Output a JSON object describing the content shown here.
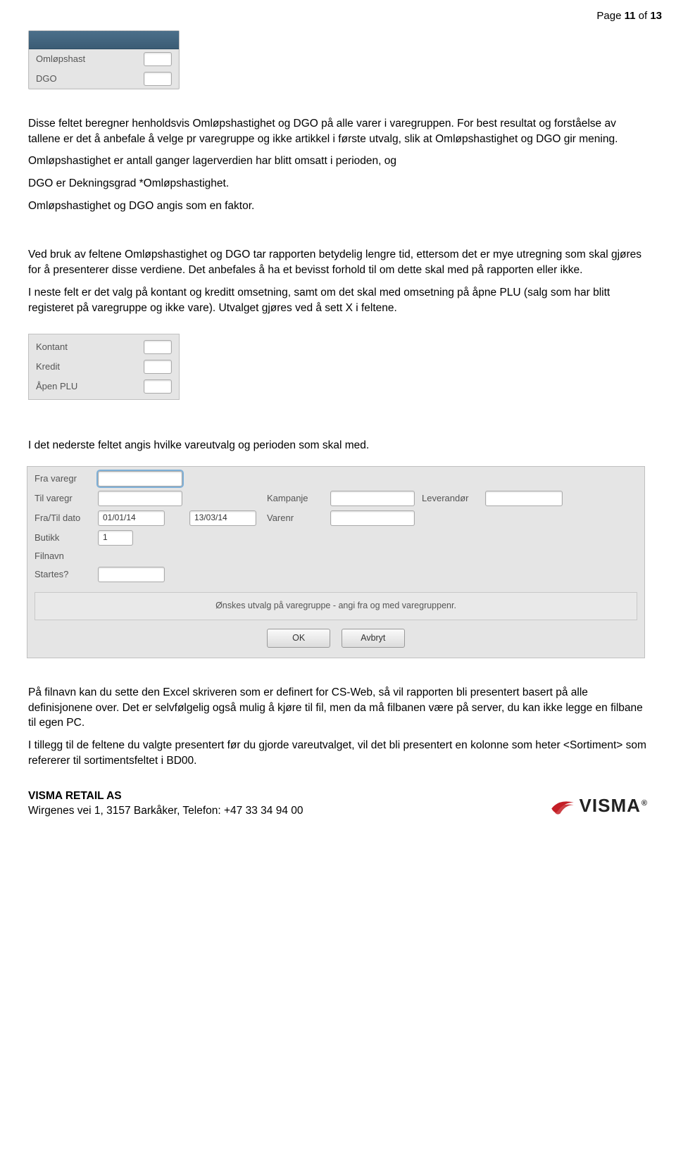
{
  "page_number_prefix": "Page ",
  "page_number_current": "11",
  "page_number_of": " of ",
  "page_number_total": "13",
  "panel1": {
    "row1": "Omløpshast",
    "row2": "DGO"
  },
  "body": {
    "p1": "Disse feltet beregner henholdsvis Omløpshastighet og DGO på alle varer i varegruppen. For best resultat og forståelse av tallene er det å anbefale å velge pr varegruppe og ikke artikkel i første utvalg, slik at Omløpshastighet og DGO gir mening.",
    "p2": "Omløpshastighet er antall ganger lagerverdien har blitt omsatt i perioden, og",
    "p3": "DGO er Dekningsgrad *Omløpshastighet.",
    "p4": "Omløpshastighet og DGO angis som en faktor.",
    "p5": "Ved bruk av feltene Omløpshastighet og DGO tar rapporten betydelig lengre tid, ettersom det er mye utregning som skal gjøres for å presenterer disse verdiene. Det anbefales å ha et bevisst forhold til om dette skal med på rapporten eller ikke.",
    "p6": "I neste felt er det valg på kontant og kreditt omsetning, samt om det skal med omsetning på åpne PLU (salg som har blitt registeret på varegruppe og ikke vare). Utvalget gjøres ved å sett X i feltene.",
    "p7": "I det nederste feltet angis hvilke vareutvalg og perioden som skal med.",
    "p8": "På filnavn kan du sette den Excel skriveren som er definert for CS-Web, så vil rapporten bli presentert basert på alle definisjonene over. Det er selvfølgelig også mulig å kjøre til fil, men da må filbanen være på server, du kan ikke legge en filbane til egen PC.",
    "p9": "I tillegg til de feltene du valgte presentert før du gjorde vareutvalget, vil det bli presentert en kolonne som heter <Sortiment> som refererer til sortimentsfeltet i BD00."
  },
  "panel2": {
    "row1": "Kontant",
    "row2": "Kredit",
    "row3": "Åpen PLU"
  },
  "form": {
    "fra_varegr": "Fra varegr",
    "til_varegr": "Til varegr",
    "kampanje": "Kampanje",
    "leverandor": "Leverandør",
    "fra_til_dato": "Fra/Til dato",
    "dato_fra_val": "01/01/14",
    "dato_til_val": "13/03/14",
    "varenr": "Varenr",
    "butikk": "Butikk",
    "butikk_val": "1",
    "filnavn": "Filnavn",
    "startes": "Startes?",
    "note": "Ønskes utvalg på varegruppe - angi fra og med varegruppenr.",
    "ok": "OK",
    "avbryt": "Avbryt"
  },
  "footer": {
    "company": "VISMA RETAIL AS",
    "address": "Wirgenes vei 1, 3157 Barkåker, Telefon: +47 33 34 94 00",
    "logo_word": "VISMA",
    "logo_reg": "®"
  }
}
